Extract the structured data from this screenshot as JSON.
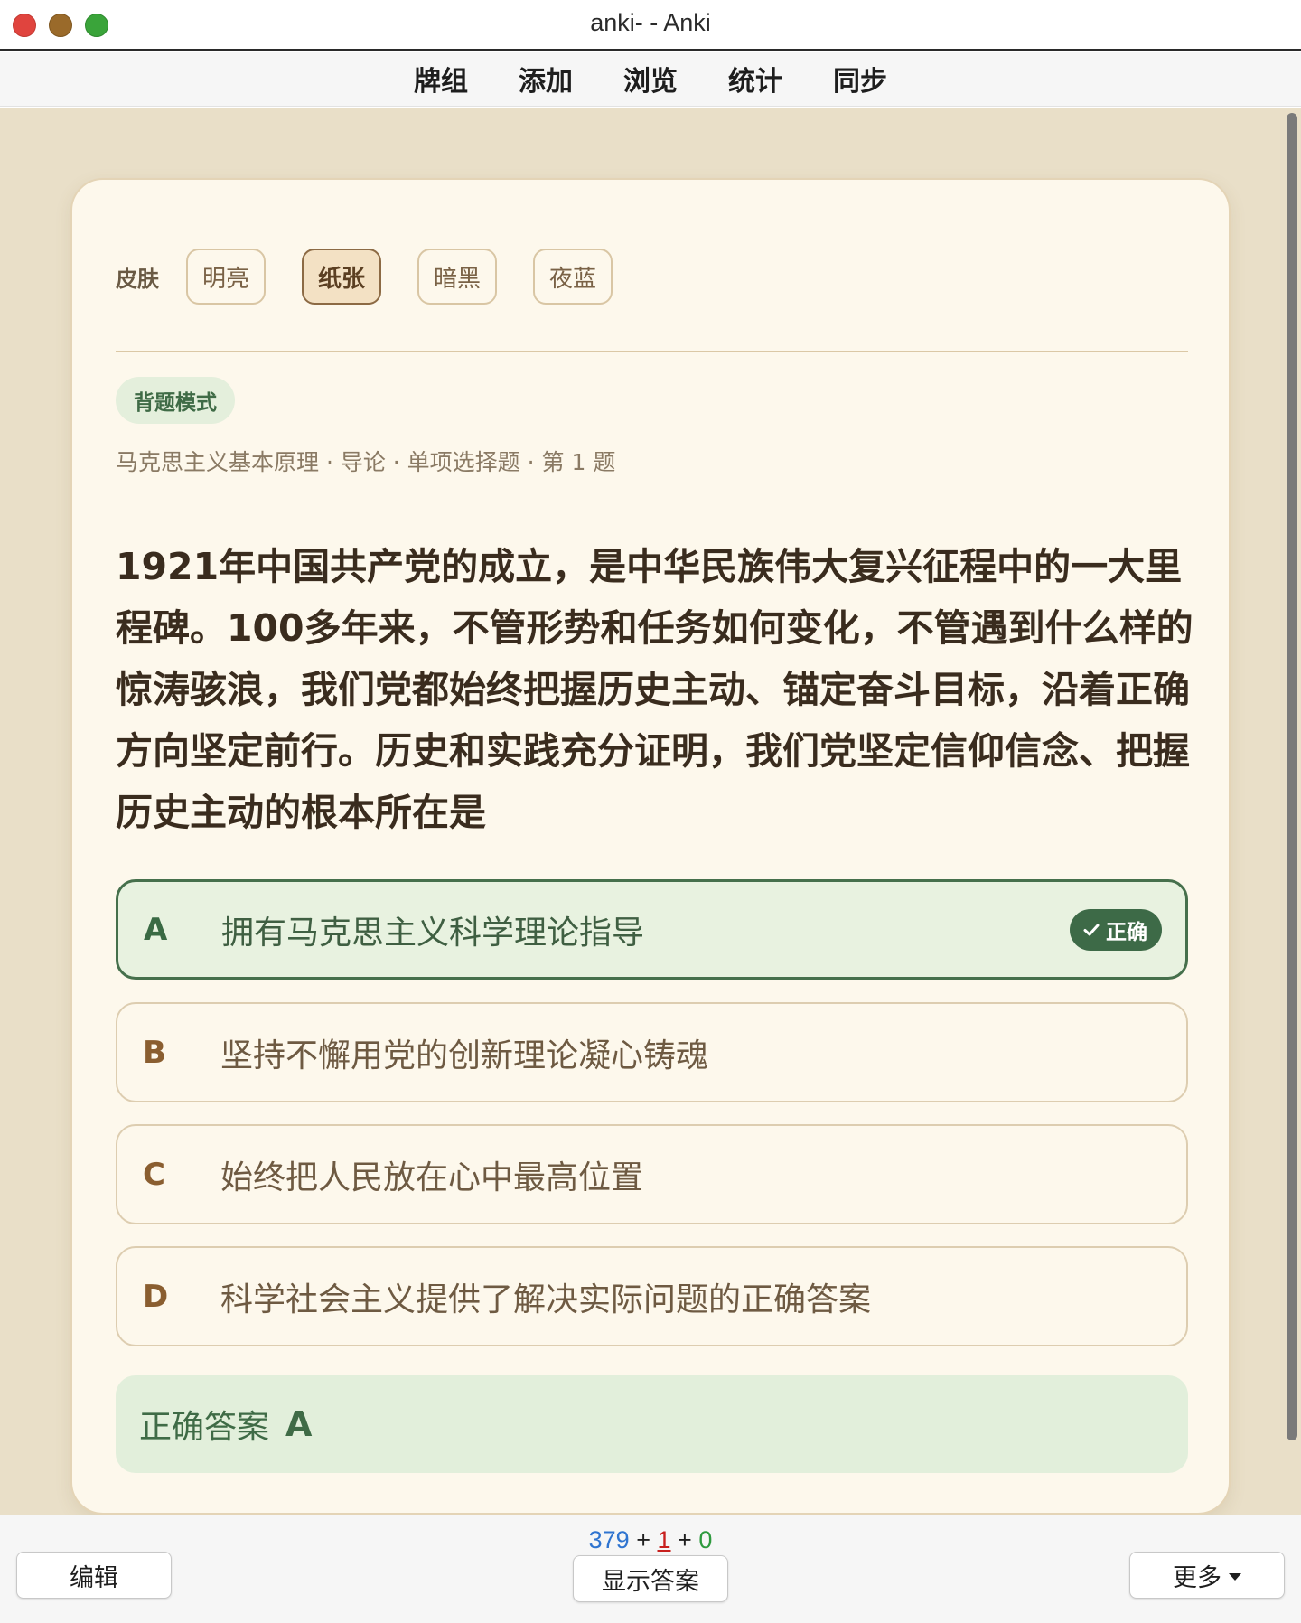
{
  "window": {
    "title": "anki- - Anki"
  },
  "toolbar": {
    "items": [
      "牌组",
      "添加",
      "浏览",
      "统计",
      "同步"
    ]
  },
  "card": {
    "skin_label": "皮肤",
    "skins": [
      "明亮",
      "纸张",
      "暗黑",
      "夜蓝"
    ],
    "active_skin": "纸张",
    "mode_badge": "背题模式",
    "breadcrumb": "马克思主义基本原理 · 导论 · 单项选择题 · 第 1 题",
    "question": "1921年中国共产党的成立，是中华民族伟大复兴征程中的一大里程碑。100多年来，不管形势和任务如何变化，不管遇到什么样的惊涛骇浪，我们党都始终把握历史主动、锚定奋斗目标，沿着正确方向坚定前行。历史和实践充分证明，我们党坚定信仰信念、把握历史主动的根本所在是",
    "options": [
      {
        "letter": "A",
        "text": "拥有马克思主义科学理论指导",
        "correct": true
      },
      {
        "letter": "B",
        "text": "坚持不懈用党的创新理论凝心铸魂",
        "correct": false
      },
      {
        "letter": "C",
        "text": "始终把人民放在心中最高位置",
        "correct": false
      },
      {
        "letter": "D",
        "text": "科学社会主义提供了解决实际问题的正确答案",
        "correct": false
      }
    ],
    "correct_tag": "正确",
    "answer_label": "正确答案",
    "answer_value": "A"
  },
  "bottombar": {
    "count_new": "379",
    "plus1": "+",
    "count_learn": "1",
    "plus2": "+",
    "count_review": "0",
    "edit_label": "编辑",
    "show_answer_label": "显示答案",
    "more_label": "更多"
  },
  "colors": {
    "background": "#e9dfc8",
    "card": "#fdf8ec",
    "correct_green": "#3d6a47",
    "count_new": "#2f74d0",
    "count_learn": "#c8201e",
    "count_review": "#2e9a3e"
  }
}
